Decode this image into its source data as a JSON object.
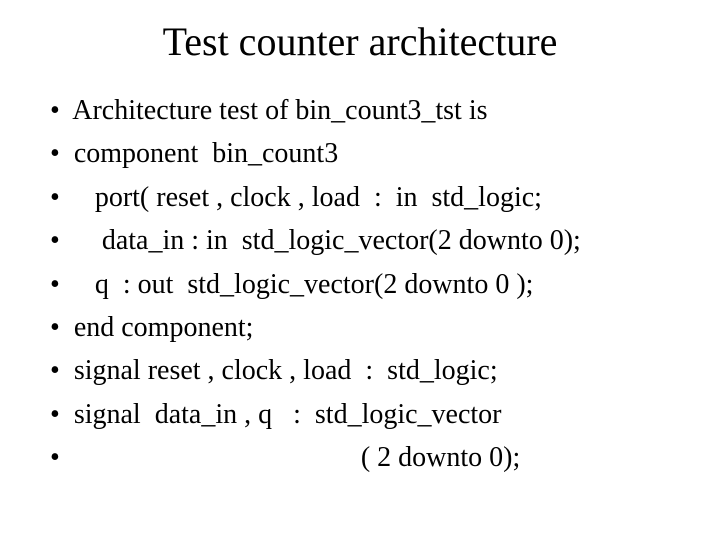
{
  "slide": {
    "title": "Test counter architecture",
    "bullets": [
      "Architecture test of bin_count3_tst is",
      "component  bin_count3",
      "   port( reset , clock , load  :  in  std_logic;",
      "    data_in : in  std_logic_vector(2 downto 0);",
      "   q  : out  std_logic_vector(2 downto 0 );",
      "end component;",
      "signal reset , clock , load  :  std_logic;",
      "signal  data_in , q   :  std_logic_vector",
      "                                         ( 2 downto 0);"
    ]
  }
}
